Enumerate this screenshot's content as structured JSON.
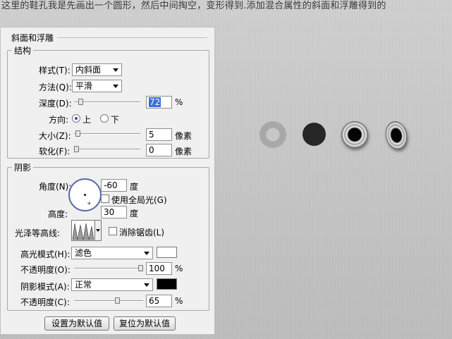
{
  "caption": "这里的鞋孔我是先画出一个圆形，然后中间掏空，变形得到.添加混合属性的斜面和浮雕得到的",
  "panel_title": "斜面和浮雕",
  "structure": {
    "legend": "结构",
    "style_label": "样式(T):",
    "style_value": "内斜面",
    "method_label": "方法(Q):",
    "method_value": "平滑",
    "depth_label": "深度(D):",
    "depth_value": "72",
    "depth_unit": "%",
    "direction_label": "方向:",
    "dir_up": "上",
    "dir_down": "下",
    "dir_selected": "上",
    "size_label": "大小(Z):",
    "size_value": "5",
    "size_unit": "像素",
    "soften_label": "软化(F):",
    "soften_value": "0",
    "soften_unit": "像素"
  },
  "shading": {
    "legend": "阴影",
    "angle_label": "角度(N):",
    "angle_value": "-60",
    "angle_unit": "度",
    "global_light_label": "使用全局光(G)",
    "global_light_checked": false,
    "altitude_label": "高度:",
    "altitude_value": "30",
    "altitude_unit": "度",
    "gloss_label": "光泽等高线:",
    "antialias_label": "消除锯齿(L)",
    "antialias_checked": false,
    "highlight_mode_label": "高光模式(H):",
    "highlight_mode_value": "滤色",
    "highlight_color": "#ffffff",
    "opacity1_label": "不透明度(O):",
    "opacity1_value": "100",
    "opacity1_unit": "%",
    "shadow_mode_label": "阴影模式(A):",
    "shadow_mode_value": "正常",
    "shadow_color": "#000000",
    "opacity2_label": "不透明度(C):",
    "opacity2_value": "65",
    "opacity2_unit": "%"
  },
  "buttons": {
    "set_default": "设置为默认值",
    "reset_default": "复位为默认值"
  },
  "sliders": {
    "depth_fraction": 0.07,
    "size_fraction": 0.02,
    "soften_fraction": 0.0,
    "opacity1_fraction": 1.0,
    "opacity2_fraction": 0.65
  }
}
